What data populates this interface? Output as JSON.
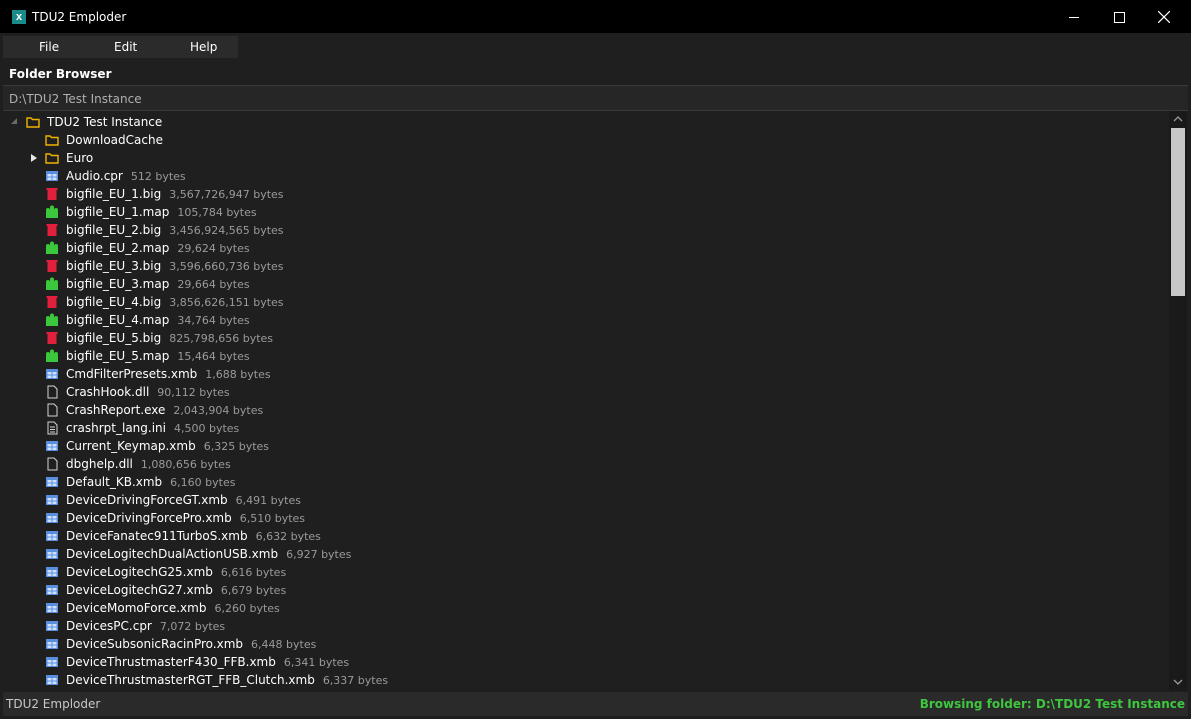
{
  "window": {
    "title": "TDU2 Emploder",
    "app_icon_letter": "x"
  },
  "menu": {
    "file": "File",
    "edit": "Edit",
    "help": "Help"
  },
  "browser": {
    "title": "Folder Browser",
    "path": "D:\\TDU2 Test Instance"
  },
  "tree": {
    "root": {
      "label": "TDU2 Test Instance",
      "expanded": true
    },
    "items": [
      {
        "name": "DownloadCache",
        "size": "",
        "icon": "folder-icon",
        "expander": false
      },
      {
        "name": "Euro",
        "size": "",
        "icon": "folder-icon",
        "expander": true
      },
      {
        "name": "Audio.cpr",
        "size": "512 bytes",
        "icon": "grid-file-icon"
      },
      {
        "name": "bigfile_EU_1.big",
        "size": "3,567,726,947 bytes",
        "icon": "bigfile-icon"
      },
      {
        "name": "bigfile_EU_1.map",
        "size": "105,784 bytes",
        "icon": "map-file-icon"
      },
      {
        "name": "bigfile_EU_2.big",
        "size": "3,456,924,565 bytes",
        "icon": "bigfile-icon"
      },
      {
        "name": "bigfile_EU_2.map",
        "size": "29,624 bytes",
        "icon": "map-file-icon"
      },
      {
        "name": "bigfile_EU_3.big",
        "size": "3,596,660,736 bytes",
        "icon": "bigfile-icon"
      },
      {
        "name": "bigfile_EU_3.map",
        "size": "29,664 bytes",
        "icon": "map-file-icon"
      },
      {
        "name": "bigfile_EU_4.big",
        "size": "3,856,626,151 bytes",
        "icon": "bigfile-icon"
      },
      {
        "name": "bigfile_EU_4.map",
        "size": "34,764 bytes",
        "icon": "map-file-icon"
      },
      {
        "name": "bigfile_EU_5.big",
        "size": "825,798,656 bytes",
        "icon": "bigfile-icon"
      },
      {
        "name": "bigfile_EU_5.map",
        "size": "15,464 bytes",
        "icon": "map-file-icon"
      },
      {
        "name": "CmdFilterPresets.xmb",
        "size": "1,688 bytes",
        "icon": "grid-file-icon"
      },
      {
        "name": "CrashHook.dll",
        "size": "90,112 bytes",
        "icon": "blank-file-icon"
      },
      {
        "name": "CrashReport.exe",
        "size": "2,043,904 bytes",
        "icon": "blank-file-icon"
      },
      {
        "name": "crashrpt_lang.ini",
        "size": "4,500 bytes",
        "icon": "text-file-icon"
      },
      {
        "name": "Current_Keymap.xmb",
        "size": "6,325 bytes",
        "icon": "grid-file-icon"
      },
      {
        "name": "dbghelp.dll",
        "size": "1,080,656 bytes",
        "icon": "blank-file-icon"
      },
      {
        "name": "Default_KB.xmb",
        "size": "6,160 bytes",
        "icon": "grid-file-icon"
      },
      {
        "name": "DeviceDrivingForceGT.xmb",
        "size": "6,491 bytes",
        "icon": "grid-file-icon"
      },
      {
        "name": "DeviceDrivingForcePro.xmb",
        "size": "6,510 bytes",
        "icon": "grid-file-icon"
      },
      {
        "name": "DeviceFanatec911TurboS.xmb",
        "size": "6,632 bytes",
        "icon": "grid-file-icon"
      },
      {
        "name": "DeviceLogitechDualActionUSB.xmb",
        "size": "6,927 bytes",
        "icon": "grid-file-icon"
      },
      {
        "name": "DeviceLogitechG25.xmb",
        "size": "6,616 bytes",
        "icon": "grid-file-icon"
      },
      {
        "name": "DeviceLogitechG27.xmb",
        "size": "6,679 bytes",
        "icon": "grid-file-icon"
      },
      {
        "name": "DeviceMomoForce.xmb",
        "size": "6,260 bytes",
        "icon": "grid-file-icon"
      },
      {
        "name": "DevicesPC.cpr",
        "size": "7,072 bytes",
        "icon": "grid-file-icon"
      },
      {
        "name": "DeviceSubsonicRacinPro.xmb",
        "size": "6,448 bytes",
        "icon": "grid-file-icon"
      },
      {
        "name": "DeviceThrustmasterF430_FFB.xmb",
        "size": "6,341 bytes",
        "icon": "grid-file-icon"
      },
      {
        "name": "DeviceThrustmasterRGT_FFB_Clutch.xmb",
        "size": "6,337 bytes",
        "icon": "grid-file-icon"
      }
    ]
  },
  "status": {
    "left": "TDU2 Emploder",
    "right": "Browsing folder: D:\\TDU2 Test Instance"
  },
  "colors": {
    "folder": "#f0b400",
    "bigfile": "#e0203c",
    "map": "#3cc83c",
    "grid": "#5a8fe0",
    "status_ok": "#3fc63f"
  }
}
